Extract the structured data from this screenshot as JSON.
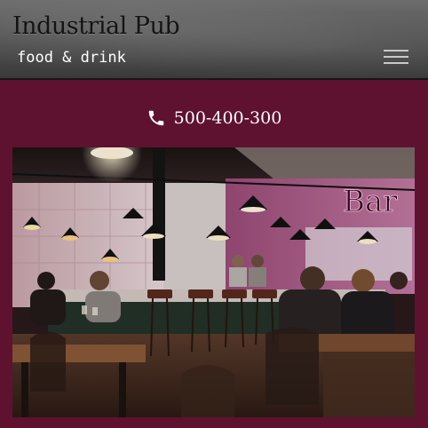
{
  "header": {
    "title": "Industrial Pub",
    "tagline": "food & drink",
    "menu_icon": "hamburger-menu-icon"
  },
  "contact": {
    "phone_icon": "phone-icon",
    "phone": "500-400-300"
  },
  "hero_image": {
    "sign_text": "Bar"
  },
  "colors": {
    "page_background": "#5f1230",
    "header_background": "#4f4f4f",
    "title_color": "#141414",
    "text_color": "#ffffff"
  }
}
